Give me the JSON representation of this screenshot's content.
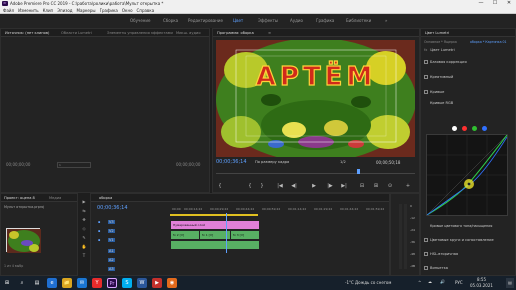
{
  "window": {
    "title": "Adobe Premiere Pro CC 2019 - C:\\работа\\ролики\\работа\\Мульт открытка *",
    "app_icon": "Pr",
    "controls": [
      "—",
      "☐",
      "✕"
    ]
  },
  "menu": [
    "Файл",
    "Изменить",
    "Клип",
    "Эпизод",
    "Маркеры",
    "Графика",
    "Окно",
    "Справка"
  ],
  "workspaces": {
    "items": [
      "Обучение",
      "Сборка",
      "Редактирование",
      "Цвет",
      "Эффекты",
      "Аудио",
      "Графика",
      "Библиотеки"
    ],
    "active": "Цвет",
    "overflow": "»"
  },
  "source_panel": {
    "tabs": [
      "Источник: (нет клипов)",
      "Области Lumetri",
      "Элементы управления эффектами",
      "Микш. аудио"
    ],
    "timecode_left": "00;00;00;00",
    "timecode_right": "00;00;00;00",
    "page": "1"
  },
  "program_monitor": {
    "tab": "Программа: оборка",
    "menu_icon": "≡",
    "overlay_text": "АРТЁМ",
    "timecode": "00;00;36;14",
    "fit": "По размеру кадра",
    "quality": "1/2",
    "duration": "00;00;50;18",
    "transport": [
      "{",
      "}",
      "|◀",
      "◀|",
      "▶",
      "|▶",
      "▶|",
      "⊟",
      "⊞",
      "⊙",
      "+"
    ]
  },
  "project_panel": {
    "tabs": [
      "Проект: оцепа 8",
      "Медиа"
    ],
    "item": "Мульт открытка.prproj",
    "count": "1 из 4 выбр"
  },
  "tools": [
    "▶",
    "⇆",
    "✥",
    "◇",
    "✎",
    "✋",
    "T"
  ],
  "timeline": {
    "tab": "оборка",
    "timecode": "00;00;36;14",
    "ruler": [
      "00;00",
      "00;00;14;22",
      "00;00;29;22",
      "00;00;44;22",
      "00;00;59;22",
      "00;01;14;22",
      "00;01;29;22",
      "00;01;44;22",
      "00;01;59;22"
    ],
    "tracks": [
      "V3",
      "V2",
      "V1",
      "A1",
      "A2",
      "A3"
    ],
    "clips": [
      {
        "label": "Нумерованный слой",
        "color": "#e080d8"
      },
      {
        "label": "fx 2 [V]",
        "color": "#58b063"
      },
      {
        "label": "fx 1 [V]",
        "color": "#58b063"
      },
      {
        "label": "fx 3 [V]",
        "color": "#58b063"
      }
    ]
  },
  "lumetri": {
    "tab": "Цвет Lumetri",
    "source": "Основное * Ящерка",
    "target": "оборка * Картинка 01",
    "fx_label": "Цвет Lumetri",
    "sections": [
      {
        "label": "Базовая коррекция",
        "checked": true
      },
      {
        "label": "Креативный",
        "checked": true
      },
      {
        "label": "Кривые",
        "checked": true
      }
    ],
    "curve_title": "Кривые RGB",
    "hsl_title": "Кривые цветового тона/насыщения",
    "bottom_sections": [
      {
        "label": "Цветовые круги и сопоставление",
        "checked": true
      },
      {
        "label": "HSL-вторичная",
        "checked": true
      },
      {
        "label": "Виньетка",
        "checked": true
      }
    ],
    "channels": [
      "#ffffff",
      "#ff3030",
      "#30c030",
      "#3070ff"
    ],
    "accent": "#5ea0ff",
    "bypass": "fx"
  },
  "taskbar": {
    "search_icon": "search-icon",
    "apps": [
      "⊞",
      "⌕",
      "▤",
      "e",
      "📁",
      "✉",
      "Y",
      "Pr",
      "S",
      "W",
      "▶",
      "◉"
    ],
    "weather": "-1°С  Дождь со снегом",
    "lang": "РУС",
    "time": "8:55",
    "date": "05.03.2021",
    "tray": [
      "^",
      "☁",
      "🔊"
    ]
  },
  "audio_meter": {
    "labels": [
      "0",
      "-12",
      "-24",
      "-36",
      "-48",
      "-dB"
    ]
  }
}
